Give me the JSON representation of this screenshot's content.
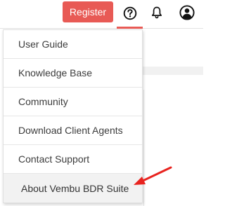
{
  "header": {
    "register_label": "Register",
    "help_icon": "question-circle-icon",
    "notification_icon": "bell-icon",
    "user_icon": "user-circle-icon"
  },
  "help_menu": {
    "items": [
      {
        "label": "User Guide"
      },
      {
        "label": "Knowledge Base"
      },
      {
        "label": "Community"
      },
      {
        "label": "Download Client Agents"
      },
      {
        "label": "Contact Support"
      },
      {
        "label": "About Vembu BDR Suite",
        "highlighted": true
      }
    ]
  },
  "annotation": {
    "type": "arrow",
    "target": "About Vembu BDR Suite"
  },
  "colors": {
    "accent": "#e85a55",
    "menu_text": "#3c3c3c",
    "highlight_bg": "#f2f2f2",
    "arrow": "#e8231f"
  }
}
